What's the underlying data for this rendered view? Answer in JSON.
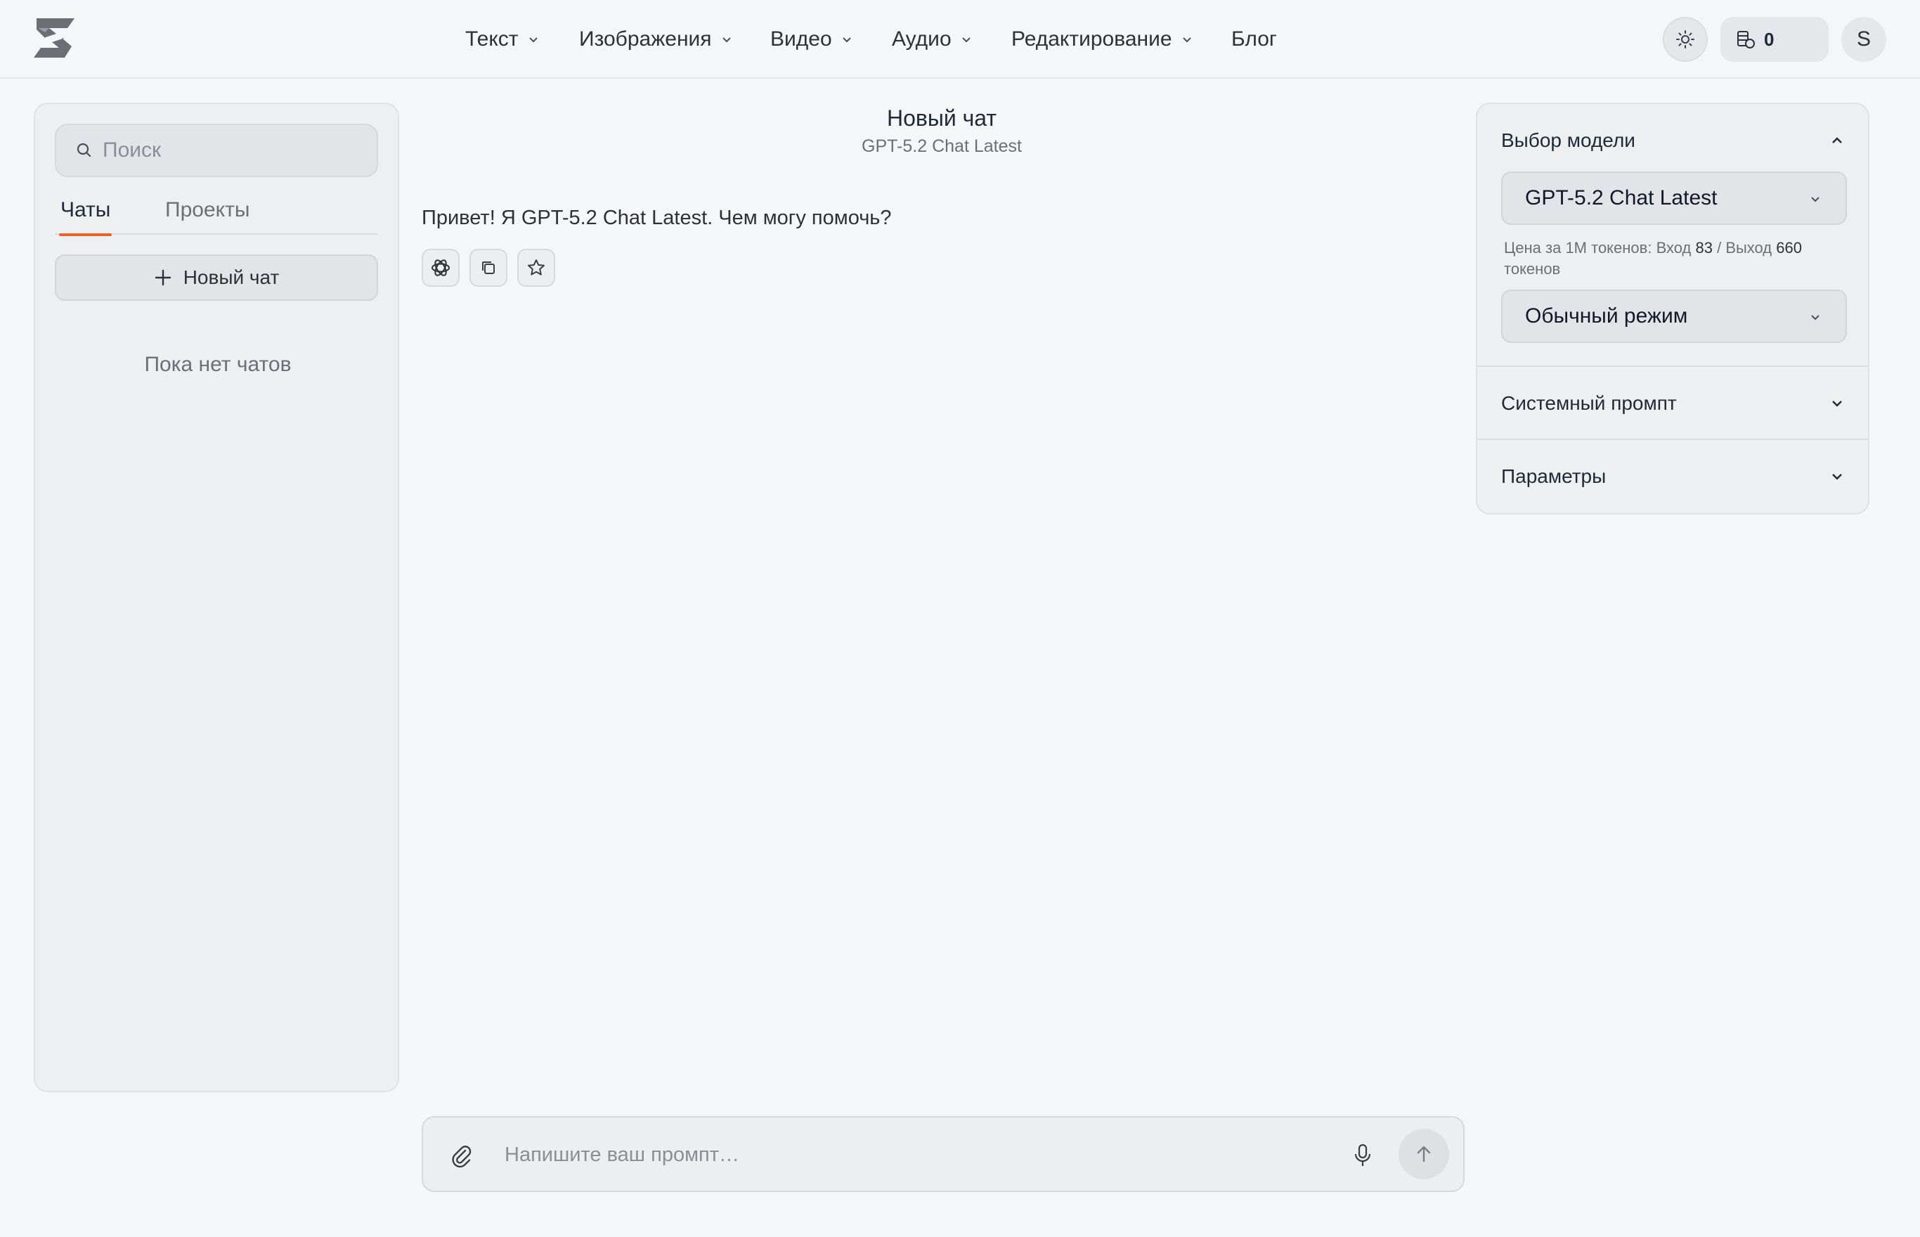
{
  "header": {
    "nav": [
      {
        "label": "Текст",
        "dropdown": true
      },
      {
        "label": "Изображения",
        "dropdown": true
      },
      {
        "label": "Видео",
        "dropdown": true
      },
      {
        "label": "Аудио",
        "dropdown": true
      },
      {
        "label": "Редактирование",
        "dropdown": true
      },
      {
        "label": "Блог",
        "dropdown": false
      }
    ],
    "balance": "0",
    "avatar_letter": "S",
    "icons": {
      "logo": "brand-logo",
      "theme": "sun-icon",
      "balance": "coins-icon"
    }
  },
  "sidebar": {
    "search_placeholder": "Поиск",
    "tabs": {
      "chats": "Чаты",
      "projects": "Проекты"
    },
    "new_chat_label": "Новый чат",
    "empty_text": "Пока нет чатов"
  },
  "chat": {
    "title": "Новый чат",
    "model_subtitle": "GPT-5.2 Chat Latest",
    "message": "Привет! Я GPT-5.2 Chat Latest. Чем могу помочь?",
    "composer_placeholder": "Напишите ваш промпт…"
  },
  "settings": {
    "model_section": {
      "title": "Выбор модели",
      "selected_model": "GPT-5.2 Chat Latest",
      "price": {
        "prefix": "Цена за 1M токенов: Вход",
        "input": "83",
        "separator": "/ Выход",
        "output": "660",
        "suffix": "токенов"
      },
      "mode": "Обычный режим"
    },
    "system_prompt": "Системный промпт",
    "params": "Параметры"
  },
  "colors": {
    "accent": "#e8622a",
    "background": "#f5f6f8",
    "panel": "#eeeff1"
  }
}
